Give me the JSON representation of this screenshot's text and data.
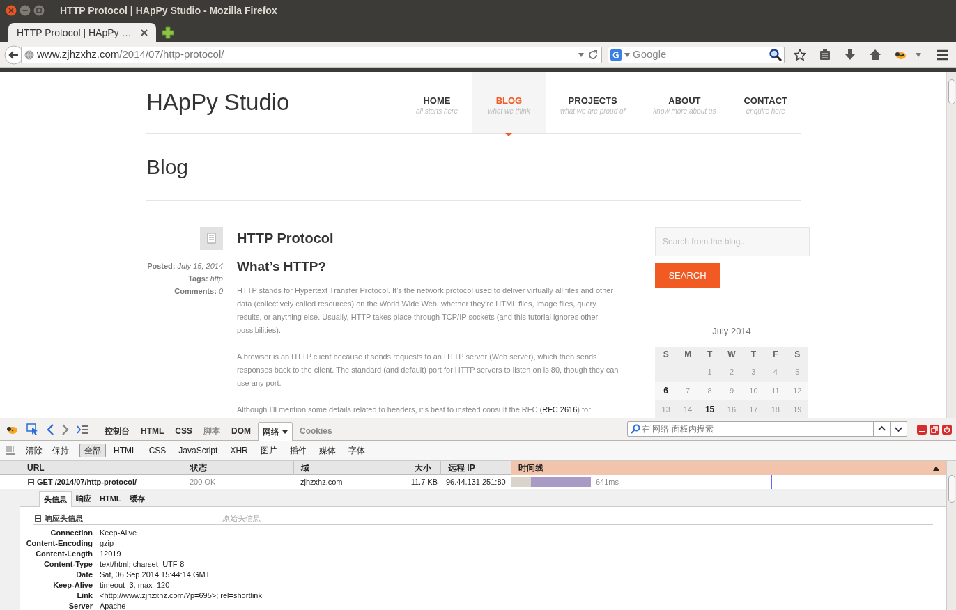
{
  "window": {
    "title": "HTTP Protocol | HApPy Studio - Mozilla Firefox"
  },
  "tabs": [
    {
      "label": "HTTP Protocol | HApPy …",
      "selected": true
    }
  ],
  "address_bar": {
    "host": "www.zjhzxhz.com",
    "path": "/2014/07/http-protocol/"
  },
  "search_bar": {
    "placeholder": "Google"
  },
  "site": {
    "logo": "HApPy Studio",
    "nav": [
      {
        "label": "HOME",
        "sub": "all starts here",
        "selected": false
      },
      {
        "label": "BLOG",
        "sub": "what we think",
        "selected": true
      },
      {
        "label": "PROJECTS",
        "sub": "what we are proud of",
        "selected": false
      },
      {
        "label": "ABOUT",
        "sub": "know more about us",
        "selected": false
      },
      {
        "label": "CONTACT",
        "sub": "enquire here",
        "selected": false
      }
    ],
    "page_title": "Blog",
    "post": {
      "title": "HTTP Protocol",
      "heading": "What’s HTTP?",
      "meta": [
        {
          "label": "Posted:",
          "value": "July 15, 2014"
        },
        {
          "label": "Tags:",
          "value": "http"
        },
        {
          "label": "Comments:",
          "value": "0"
        }
      ],
      "paragraphs": [
        "HTTP stands for Hypertext Transfer Protocol. It’s the network protocol used to deliver virtually all files and other data (collectively called resources) on the World Wide Web, whether they’re HTML files, image files, query results, or anything else. Usually, HTTP takes place through TCP/IP sockets (and this tutorial ignores other possibilities).",
        "A browser is an HTTP client because it sends requests to an HTTP server (Web server), which then sends responses back to the client. The standard (and default) port for HTTP servers to listen on is 80, though they can use any port.",
        "Although I’ll mention some details related to headers, it’s best to instead consult the RFC (**RFC 2616**) for"
      ]
    },
    "sidebar": {
      "search_placeholder": "Search from the blog...",
      "search_button": "SEARCH",
      "calendar": {
        "caption": "July 2014",
        "weekdays": [
          "S",
          "M",
          "T",
          "W",
          "T",
          "F",
          "S"
        ],
        "weeks": [
          [
            {
              "kind": "empty"
            },
            {
              "kind": "empty"
            },
            {
              "kind": "day",
              "day": "1",
              "bold": false
            },
            {
              "kind": "day",
              "day": "2",
              "bold": false
            },
            {
              "kind": "day",
              "day": "3",
              "bold": false
            },
            {
              "kind": "day",
              "day": "4",
              "bold": false
            },
            {
              "kind": "day",
              "day": "5",
              "bold": false
            }
          ],
          [
            {
              "kind": "day",
              "day": "6",
              "bold": true
            },
            {
              "kind": "day",
              "day": "7",
              "bold": false
            },
            {
              "kind": "day",
              "day": "8",
              "bold": false
            },
            {
              "kind": "day",
              "day": "9",
              "bold": false
            },
            {
              "kind": "day",
              "day": "10",
              "bold": false
            },
            {
              "kind": "day",
              "day": "11",
              "bold": false
            },
            {
              "kind": "day",
              "day": "12",
              "bold": false
            }
          ],
          [
            {
              "kind": "day",
              "day": "13",
              "bold": false
            },
            {
              "kind": "day",
              "day": "14",
              "bold": false
            },
            {
              "kind": "day",
              "day": "15",
              "bold": true
            },
            {
              "kind": "day",
              "day": "16",
              "bold": false
            },
            {
              "kind": "day",
              "day": "17",
              "bold": false
            },
            {
              "kind": "day",
              "day": "18",
              "bold": false
            },
            {
              "kind": "day",
              "day": "19",
              "bold": false
            }
          ]
        ]
      }
    }
  },
  "devtools": {
    "panel_tabs": [
      {
        "label": "控制台",
        "selected": false,
        "disabled": false
      },
      {
        "label": "HTML",
        "selected": false,
        "disabled": false
      },
      {
        "label": "CSS",
        "selected": false,
        "disabled": false
      },
      {
        "label": "脚本",
        "selected": false,
        "disabled": true
      },
      {
        "label": "DOM",
        "selected": false,
        "disabled": false
      },
      {
        "label": "网络",
        "selected": true,
        "disabled": false
      },
      {
        "label": "Cookies",
        "selected": false,
        "disabled": true
      }
    ],
    "search_placeholder": "在 网络 面板内搜索",
    "actions": [
      "清除",
      "保持"
    ],
    "filters": [
      {
        "label": "全部",
        "selected": true
      },
      {
        "label": "HTML",
        "selected": false
      },
      {
        "label": "CSS",
        "selected": false
      },
      {
        "label": "JavaScript",
        "selected": false
      },
      {
        "label": "XHR",
        "selected": false
      },
      {
        "label": "图片",
        "selected": false
      },
      {
        "label": "插件",
        "selected": false
      },
      {
        "label": "媒体",
        "selected": false
      },
      {
        "label": "字体",
        "selected": false
      }
    ],
    "columns": [
      "URL",
      "状态",
      "域",
      "大小",
      "远程 IP",
      "时间线"
    ],
    "requests": [
      {
        "expanded": true,
        "url": "GET /2014/07/http-protocol/",
        "status": "200 OK",
        "domain": "zjhzxhz.com",
        "size": "11.7 KB",
        "remote_ip": "96.44.131.251:80",
        "time": "641ms"
      }
    ],
    "detail_tabs": [
      {
        "label": "头信息",
        "selected": true
      },
      {
        "label": "响应",
        "selected": false
      },
      {
        "label": "HTML",
        "selected": false
      },
      {
        "label": "缓存",
        "selected": false
      }
    ],
    "section": {
      "title": "响应头信息",
      "expanded": true,
      "raw_link": "原始头信息"
    },
    "headers": [
      {
        "name": "Connection",
        "value": "Keep-Alive"
      },
      {
        "name": "Content-Encoding",
        "value": "gzip"
      },
      {
        "name": "Content-Length",
        "value": "12019"
      },
      {
        "name": "Content-Type",
        "value": "text/html; charset=UTF-8"
      },
      {
        "name": "Date",
        "value": "Sat, 06 Sep 2014 15:44:14 GMT"
      },
      {
        "name": "Keep-Alive",
        "value": "timeout=3, max=120"
      },
      {
        "name": "Link",
        "value": "<http://www.zjhzxhz.com/?p=695>; rel=shortlink"
      },
      {
        "name": "Server",
        "value": "Apache"
      }
    ]
  }
}
